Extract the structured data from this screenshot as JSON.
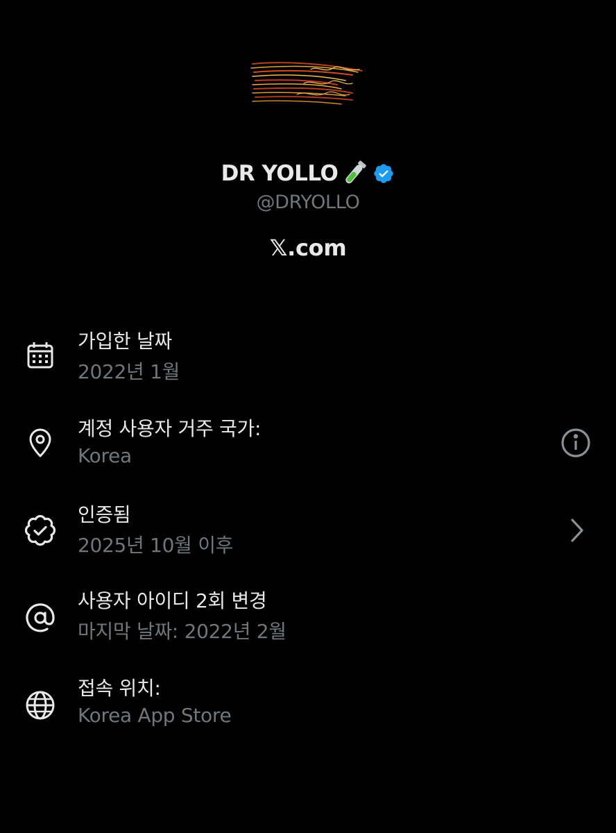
{
  "profile": {
    "display_name": "DR YOLLO",
    "handle": "@DRYOLLO",
    "source": "𝕏.com",
    "avatar_icon": "red-yellow-streak-logo",
    "name_emoji": "test-tube-icon",
    "verified_badge": "verified-badge-icon",
    "verified_color": "#1d9bf0"
  },
  "items": [
    {
      "icon": "calendar-icon",
      "title": "가입한 날짜",
      "subtitle": "2022년 1월"
    },
    {
      "icon": "location-pin-icon",
      "title": "계정 사용자 거주 국가:",
      "subtitle": "Korea",
      "trailing_icon": "info-icon"
    },
    {
      "icon": "verified-check-icon",
      "title": "인증됨",
      "subtitle": "2025년 10월 이후",
      "trailing_icon": "chevron-right-icon"
    },
    {
      "icon": "at-sign-icon",
      "title": "사용자 아이디 2회 변경",
      "subtitle": "마지막 날짜: 2022년 2월"
    },
    {
      "icon": "globe-icon",
      "title": "접속 위치:",
      "subtitle": "Korea App Store"
    }
  ],
  "colors": {
    "background": "#000000",
    "primary_text": "#e7e9ea",
    "secondary_text": "#71767b"
  }
}
